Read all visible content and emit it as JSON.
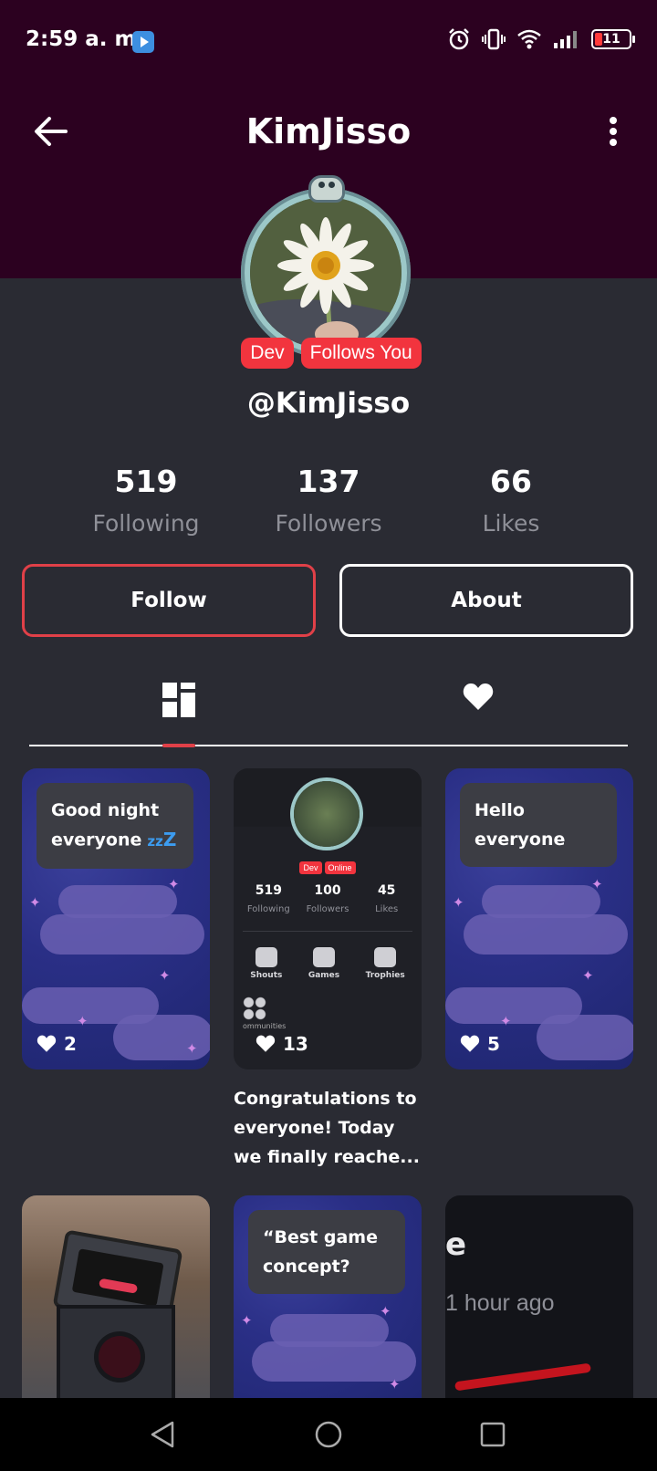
{
  "status_bar": {
    "time": "2:59 a. m.",
    "battery_level": "11",
    "icons": [
      "alarm-icon",
      "vibrate-icon",
      "wifi-icon",
      "signal-icon",
      "battery-icon"
    ]
  },
  "header": {
    "title": "KimJisso",
    "back_icon": "arrow-left-icon",
    "menu_icon": "more-vertical-icon",
    "background": "#2c0120"
  },
  "profile": {
    "badges": [
      "Dev",
      "Follows You"
    ],
    "handle": "@KimJisso",
    "stats": [
      {
        "value": "519",
        "label": "Following"
      },
      {
        "value": "137",
        "label": "Followers"
      },
      {
        "value": "66",
        "label": "Likes"
      }
    ],
    "follow_label": "Follow",
    "about_label": "About",
    "accent_color": "#e04048"
  },
  "tabs": [
    {
      "icon": "grid-icon",
      "active": true
    },
    {
      "icon": "heart-icon",
      "active": false
    }
  ],
  "posts": [
    {
      "text_line1": "Good night",
      "text_line2": "everyone",
      "likes": "2"
    },
    {
      "likes": "13",
      "caption": "Congratulations to everyone! Today we finally reache...",
      "mini": {
        "badges": [
          "Dev",
          "Online"
        ],
        "stats": [
          {
            "value": "519",
            "label": "Following"
          },
          {
            "value": "100",
            "label": "Followers"
          },
          {
            "value": "45",
            "label": "Likes"
          }
        ],
        "menu": [
          "Shouts",
          "Games",
          "Trophies"
        ],
        "community_label": "ommunities"
      }
    },
    {
      "text_line1": "Hello",
      "text_line2": "everyone",
      "likes": "5"
    },
    {
      "type": "image"
    },
    {
      "text": "“Best game concept?"
    },
    {
      "letter": "e",
      "time": "1 hour ago"
    }
  ],
  "nav_bar": {
    "buttons": [
      "back-triangle-icon",
      "home-circle-icon",
      "recents-square-icon"
    ]
  }
}
